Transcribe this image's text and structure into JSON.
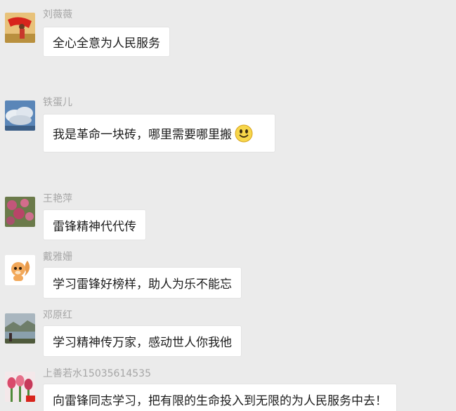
{
  "messages": [
    {
      "sender": "刘薇薇",
      "text": "全心全意为人民服务",
      "avatar": "avatar-red-flag-photo"
    },
    {
      "sender": "铁蛋儿",
      "text": "我是革命一块砖，哪里需要哪里搬",
      "emoji": "smiley-icon",
      "avatar": "avatar-sky-clouds-photo"
    },
    {
      "sender": "王艳萍",
      "text": "雷锋精神代代传",
      "avatar": "avatar-flowers-photo"
    },
    {
      "sender": "戴雅姗",
      "text": "学习雷锋好榜样，助人为乐不能忘",
      "avatar": "avatar-cartoon-squirrel"
    },
    {
      "sender": "邓原红",
      "text": "学习精神传万家，感动世人你我他",
      "avatar": "avatar-lake-scene-photo"
    },
    {
      "sender": "上善若水15035614535",
      "text": "向雷锋同志学习，把有限的生命投入到无限的为人民服务中去！",
      "avatar": "avatar-tulips-photo"
    }
  ],
  "colors": {
    "background": "#ebebeb",
    "bubble": "#ffffff",
    "sender_name": "#a6a6a6",
    "message_text": "#1c1c1c"
  }
}
